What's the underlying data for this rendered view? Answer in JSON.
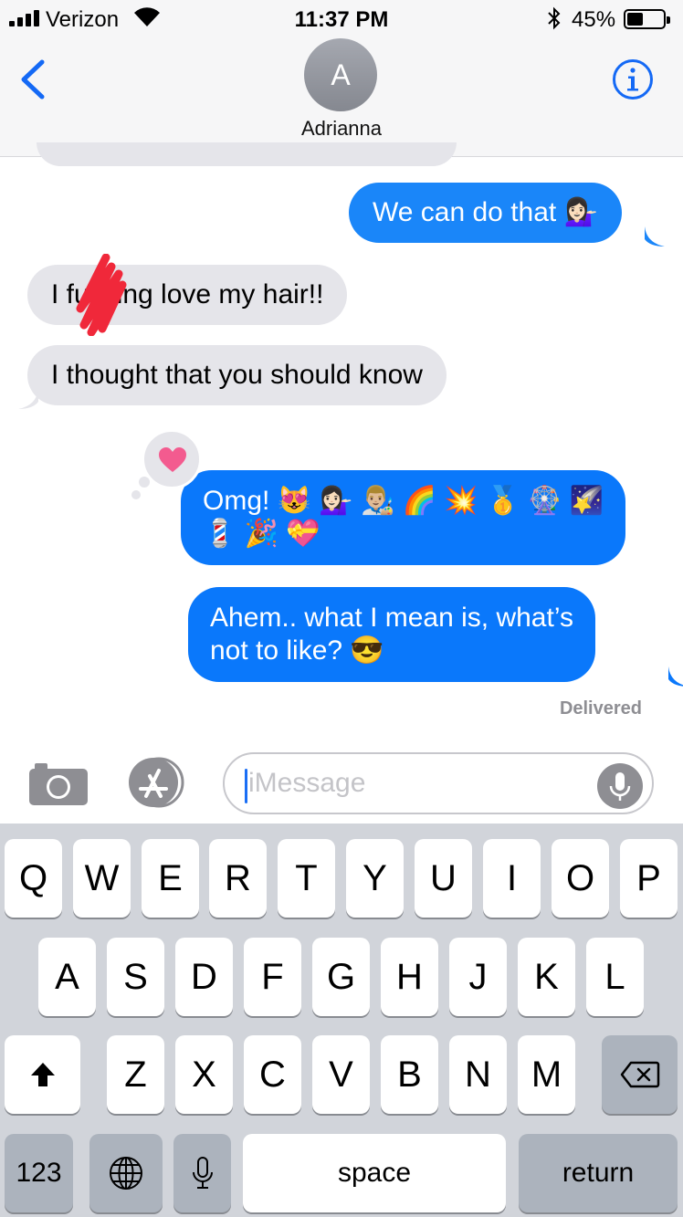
{
  "status_bar": {
    "carrier": "Verizon",
    "time": "11:37 PM",
    "battery_percent": "45%",
    "battery_level": 0.45
  },
  "header": {
    "avatar_initial": "A",
    "contact_name": "Adrianna",
    "back_icon": "chevron-left-icon",
    "info_icon": "info-icon"
  },
  "messages": [
    {
      "from": "me",
      "text": "We can do that 💁🏻‍♀️"
    },
    {
      "from": "them",
      "text": "I fucking love my hair!!",
      "redacted": true
    },
    {
      "from": "them",
      "text": "I thought that you should know"
    },
    {
      "from": "me",
      "line1": "Omg! 😻 💁🏻‍♀️ 👨🏼‍🎨 🌈 💥 🥇 🎡 🌠",
      "line2": "💈 🎉 💝",
      "tapback": "heart"
    },
    {
      "from": "me",
      "line1": "Ahem.. what I mean is, what’s",
      "line2": "not to like? 😎"
    }
  ],
  "delivery_status": "Delivered",
  "input": {
    "placeholder": "iMessage",
    "camera_icon": "camera-icon",
    "apps_icon": "app-store-icon",
    "mic_icon": "microphone-icon"
  },
  "keyboard": {
    "row1": [
      "Q",
      "W",
      "E",
      "R",
      "T",
      "Y",
      "U",
      "I",
      "O",
      "P"
    ],
    "row2": [
      "A",
      "S",
      "D",
      "F",
      "G",
      "H",
      "J",
      "K",
      "L"
    ],
    "row3": [
      "Z",
      "X",
      "C",
      "V",
      "B",
      "N",
      "M"
    ],
    "numbers": "123",
    "space": "space",
    "return": "return"
  },
  "colors": {
    "outgoing_bubble": "#1a86f9",
    "incoming_bubble": "#e5e5ea",
    "tapback_heart": "#f35b8f"
  }
}
